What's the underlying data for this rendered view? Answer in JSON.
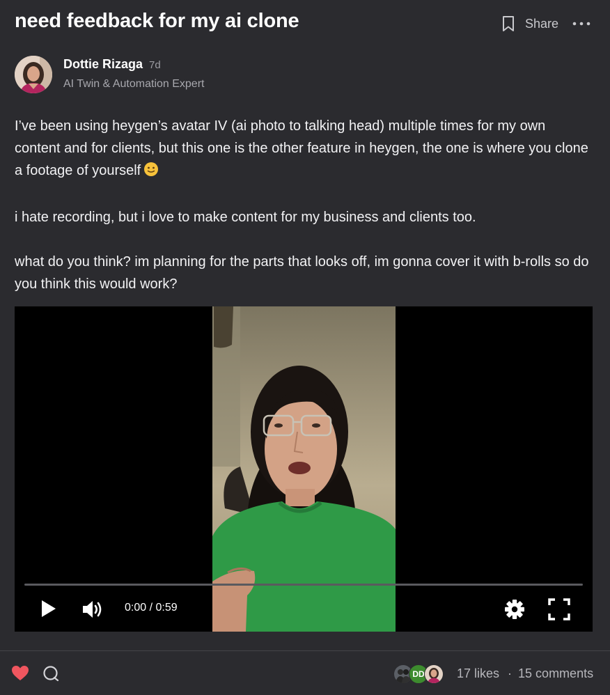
{
  "post": {
    "title": "need feedback for my ai clone",
    "share_label": "Share",
    "author": {
      "name": "Dottie Rizaga",
      "age": "7d",
      "tagline": "AI Twin & Automation Expert"
    },
    "body": [
      "I’ve been using heygen’s avatar IV (ai photo to talking head) multiple times for my own content and for clients, but this one is the other feature in heygen, the one is where you clone a footage of yourself",
      "i hate recording, but i love to make content for my business and clients too.",
      "what do you think? im planning for the parts that looks off, im gonna cover it with b-rolls so do you think this would work?"
    ],
    "body_emoji": "slightly-smiling-face-icon"
  },
  "video": {
    "time": "0:00 / 0:59",
    "progress": 0
  },
  "footer": {
    "liker_initials": "DD",
    "likes": "17 likes",
    "separator": "·",
    "comments": "15 comments"
  },
  "colors": {
    "background": "#2b2b2f",
    "like_heart": "#f0565f",
    "liker_badge": "#3d8b2e",
    "sweater": "#2f9a47"
  },
  "icons": [
    "bookmark-icon",
    "more-icon",
    "play-icon",
    "volume-icon",
    "settings-gear-icon",
    "fullscreen-icon",
    "heart-icon",
    "comment-icon"
  ]
}
